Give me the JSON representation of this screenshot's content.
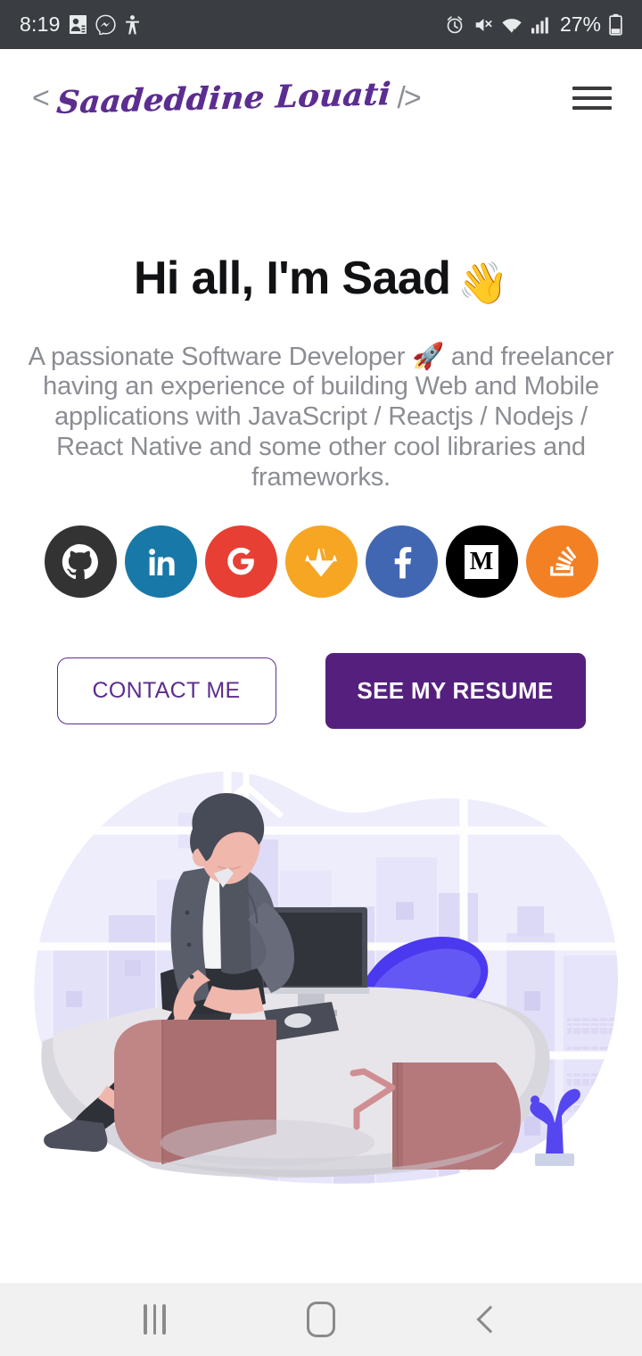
{
  "status_bar": {
    "time": "8:19",
    "battery_percent": "27%",
    "left_icons": [
      "contacts-icon",
      "messenger-icon",
      "accessibility-icon"
    ],
    "right_icons": [
      "alarm-icon",
      "volume-mute-icon",
      "wifi-icon",
      "cellular-signal-icon",
      "battery-icon"
    ]
  },
  "header": {
    "bracket_open": "<",
    "logo_text": "Saadeddine Louati",
    "bracket_close": "/>",
    "menu_icon": "hamburger-menu-icon"
  },
  "hero": {
    "heading": "Hi all, I'm Saad",
    "heading_emoji": "👋",
    "description": "A passionate Software Developer 🚀 and freelancer having an experience of building Web and Mobile applications with JavaScript / Reactjs / Nodejs / React Native and some other cool libraries and frameworks."
  },
  "socials": [
    {
      "name": "github",
      "label": "GitHub",
      "color": "#333333"
    },
    {
      "name": "linkedin",
      "label": "LinkedIn",
      "color": "#1878a8"
    },
    {
      "name": "google",
      "label": "Google",
      "color": "#e83f34"
    },
    {
      "name": "gitlab",
      "label": "GitLab",
      "color": "#f6a623"
    },
    {
      "name": "facebook",
      "label": "Facebook",
      "color": "#4267b2"
    },
    {
      "name": "medium",
      "label": "Medium",
      "color": "#000000"
    },
    {
      "name": "stackoverflow",
      "label": "Stack Overflow",
      "color": "#f48024"
    }
  ],
  "buttons": {
    "contact_label": "CONTACT ME",
    "resume_label": "SEE MY RESUME",
    "accent_color": "#55207d",
    "outline_color": "#5c2d91"
  },
  "illustration": {
    "alt": "Developer sitting on desk with computer and city skyline",
    "blob_color": "#efeefb",
    "building_color": "#e0def7",
    "chair_color": "#5546f0",
    "desk_color": "#d9d7de",
    "cabinet_color": "#b5797c",
    "cactus_color": "#5546f0"
  },
  "nav_bar": {
    "recents_icon": "recents-icon",
    "home_icon": "home-icon",
    "back_icon": "back-icon"
  }
}
